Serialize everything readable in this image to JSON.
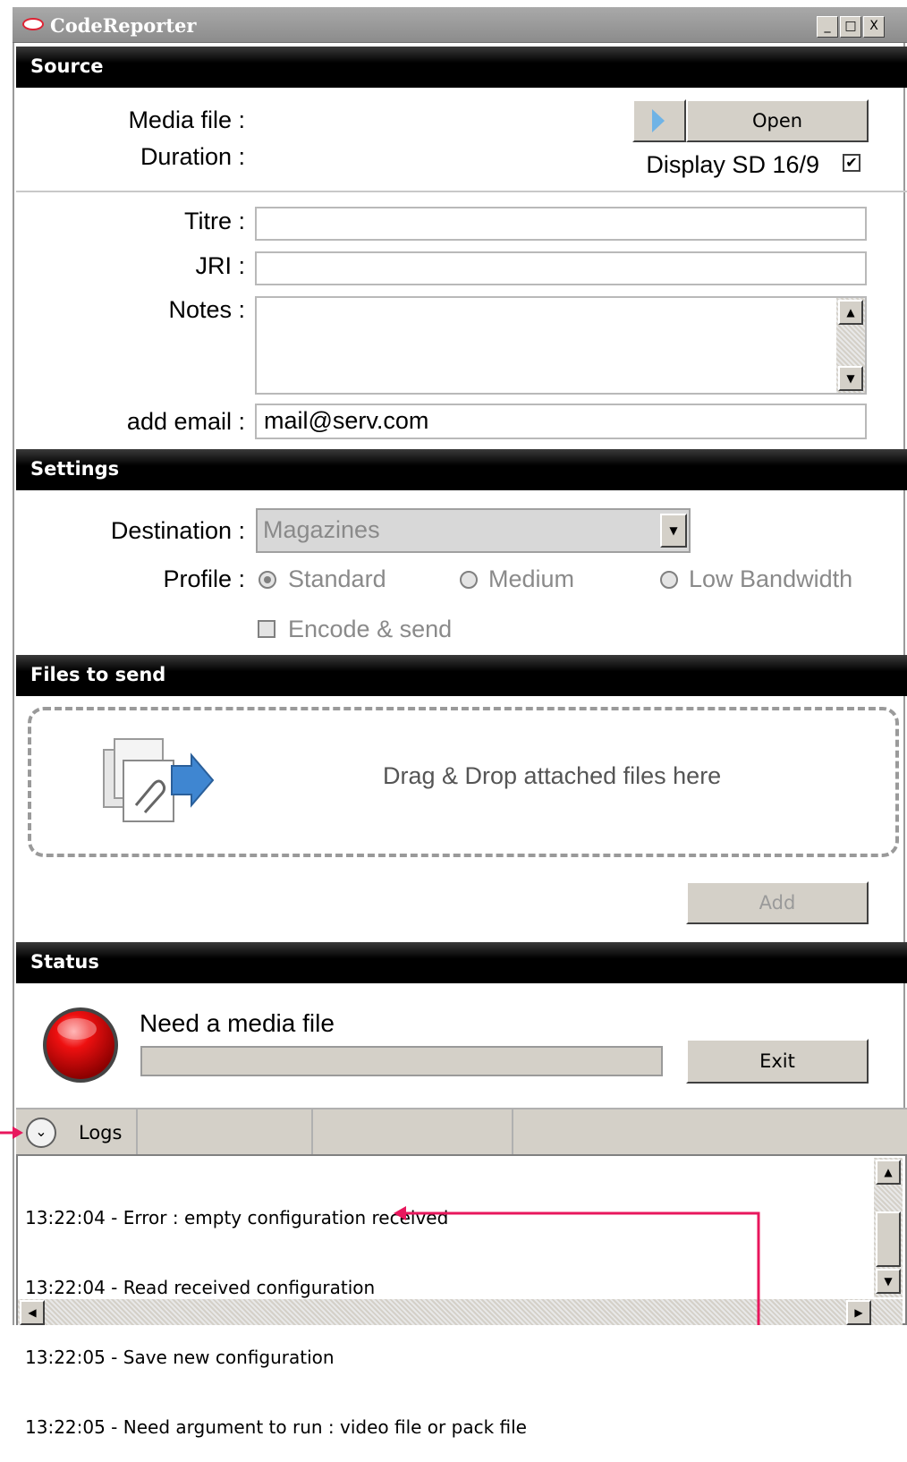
{
  "window": {
    "title": "CodeReporter",
    "controls": [
      "_",
      "□",
      "X"
    ]
  },
  "source": {
    "header": "Source",
    "media_file_label": "Media file :",
    "duration_label": "Duration :",
    "open_label": "Open",
    "display_label": "Display SD 16/9",
    "display_checked": true
  },
  "form": {
    "titre_label": "Titre :",
    "titre_value": "",
    "jri_label": "JRI :",
    "jri_value": "",
    "notes_label": "Notes :",
    "notes_value": "",
    "email_label": "add email :",
    "email_value": "mail@serv.com"
  },
  "settings": {
    "header": "Settings",
    "destination_label": "Destination :",
    "destination_value": "Magazines",
    "profile_label": "Profile :",
    "profile_options": [
      "Standard",
      "Medium",
      "Low Bandwidth"
    ],
    "profile_selected": "Standard",
    "encode_label": "Encode & send",
    "encode_checked": false
  },
  "files": {
    "header": "Files to send",
    "drop_text": "Drag & Drop attached files here",
    "add_label": "Add"
  },
  "status": {
    "header": "Status",
    "message": "Need a media file",
    "progress": 0,
    "exit_label": "Exit",
    "indicator_color": "#e00000"
  },
  "logs": {
    "tab_label": "Logs",
    "lines": [
      "13:22:04 - Error : empty configuration received",
      "13:22:04 - Read received configuration",
      "13:22:05 - Save new configuration",
      "13:22:05 - Need argument to run : video file or pack file"
    ]
  },
  "annotation_color": "#e8175d"
}
